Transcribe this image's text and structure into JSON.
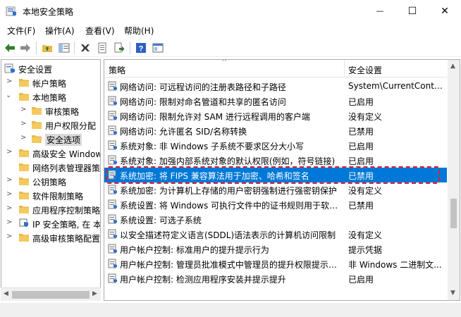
{
  "window": {
    "title": "本地安全策略",
    "minimize": "—",
    "maximize": "☐",
    "close": "✕"
  },
  "menu": [
    "文件(F)",
    "操作(A)",
    "查看(V)",
    "帮助(H)"
  ],
  "toolbar": [
    {
      "name": "back-icon"
    },
    {
      "name": "forward-icon"
    },
    {
      "name": "up-folder-icon"
    },
    {
      "name": "show-tree-icon"
    },
    {
      "name": "delete-icon"
    },
    {
      "name": "properties-icon"
    },
    {
      "name": "export-icon"
    },
    {
      "name": "help-icon"
    },
    {
      "name": "console-icon"
    }
  ],
  "tree": {
    "root": "安全设置",
    "items": [
      {
        "label": "帐户策略",
        "expanded": false
      },
      {
        "label": "本地策略",
        "expanded": true
      },
      {
        "label": "审核策略"
      },
      {
        "label": "用户权限分配"
      },
      {
        "label": "安全选项",
        "selected": true
      },
      {
        "label": "高级安全 Windows"
      },
      {
        "label": "网络列表管理器策略"
      },
      {
        "label": "公钥策略"
      },
      {
        "label": "软件限制策略"
      },
      {
        "label": "应用程序控制策略"
      },
      {
        "label": "IP 安全策略, 在 本"
      },
      {
        "label": "高级审核策略配置"
      }
    ]
  },
  "list": {
    "columns": {
      "policy": "策略",
      "setting": "安全设置"
    },
    "rows": [
      {
        "policy": "网络访问: 可远程访问的注册表路径和子路径",
        "setting": "System\\CurrentContro..."
      },
      {
        "policy": "网络访问: 限制对命名管道和共享的匿名访问",
        "setting": "已启用"
      },
      {
        "policy": "网络访问: 限制允许对 SAM 进行远程调用的客户端",
        "setting": "没有定义"
      },
      {
        "policy": "网络访问: 允许匿名 SID/名称转换",
        "setting": "已禁用"
      },
      {
        "policy": "系统对象: 非 Windows 子系统不要求区分大小写",
        "setting": "已启用"
      },
      {
        "policy": "系统对象: 加强内部系统对象的默认权限(例如，符号链接)",
        "setting": "已启用"
      },
      {
        "policy": "系统加密: 将 FIPS 兼容算法用于加密、哈希和签名",
        "setting": "已禁用",
        "selected": true
      },
      {
        "policy": "系统加密: 为计算机上存储的用户密钥强制进行强密钥保护",
        "setting": "没有定义"
      },
      {
        "policy": "系统设置: 将 Windows 可执行文件中的证书规则用于软件...",
        "setting": "已禁用"
      },
      {
        "policy": "系统设置: 可选子系统",
        "setting": ""
      },
      {
        "policy": "以安全描述符定义语言(SDDL)语法表示的计算机访问限制",
        "setting": "没有定义"
      },
      {
        "policy": "用户帐户控制: 标准用户的提升提示行为",
        "setting": "提示凭据"
      },
      {
        "policy": "用户帐户控制: 管理员批准模式中管理员的提升权限提示的...",
        "setting": "非 Windows 二进制文..."
      },
      {
        "policy": "用户帐户控制: 检测应用程序安装并提示提升",
        "setting": "已启用"
      }
    ]
  },
  "colors": {
    "selection": "#0078d7",
    "highlight": "#e0202a",
    "folder": "#e8b84a"
  }
}
